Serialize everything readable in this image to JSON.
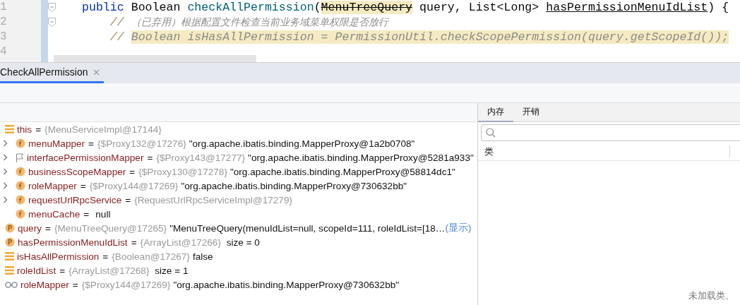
{
  "editor": {
    "lines": [
      {
        "number": "1",
        "fold": true,
        "tokens": [
          {
            "kind": "keyword",
            "text": "public"
          },
          {
            "kind": "plain",
            "text": " Boolean "
          },
          {
            "kind": "method",
            "text": "checkAllPermission"
          },
          {
            "kind": "plain",
            "text": "("
          },
          {
            "kind": "deprecated",
            "text": "MenuTreeQuery"
          },
          {
            "kind": "plain",
            "text": " query, List<Long> "
          },
          {
            "kind": "underlined",
            "text": "hasPermissionMenuIdList"
          },
          {
            "kind": "plain",
            "text": ") {"
          }
        ]
      },
      {
        "number": "2",
        "fold": true,
        "tokens": [
          {
            "kind": "slashes",
            "text": "    // "
          },
          {
            "kind": "comment",
            "text": "（已弃用）根据配置文件检查当前业务域菜单权限是否放行"
          }
        ]
      },
      {
        "number": "3",
        "fold": false,
        "tokens": [
          {
            "kind": "slashes",
            "text": "    // "
          },
          {
            "kind": "commented_code",
            "text": "Boolean isHasAllPermission = PermissionUtil.checkScopePermission(query.getScopeId());"
          }
        ]
      },
      {
        "number": "4",
        "fold": false
      }
    ]
  },
  "run_tab": {
    "label": "CheckAllPermission",
    "selected": true
  },
  "variables": [
    {
      "kind": "list",
      "name": "this",
      "operator": "=",
      "type": "{MenuServiceImpl@17144}",
      "children": [
        {
          "kind": "field",
          "expanded": false,
          "name": "menuMapper",
          "operator": "=",
          "type": "{$Proxy132@17276}",
          "value": "\"org.apache.ibatis.binding.MapperProxy@1a2b0708\""
        },
        {
          "kind": "flag",
          "expanded": false,
          "name": "interfacePermissionMapper",
          "operator": "=",
          "type": "{$Proxy143@17277}",
          "value": "\"org.apache.ibatis.binding.MapperProxy@5281a933\""
        },
        {
          "kind": "field",
          "expanded": false,
          "name": "businessScopeMapper",
          "operator": "=",
          "type": "{$Proxy130@17278}",
          "value": "\"org.apache.ibatis.binding.MapperProxy@58814dc1\""
        },
        {
          "kind": "field",
          "expanded": false,
          "name": "roleMapper",
          "operator": "=",
          "type": "{$Proxy144@17269}",
          "value": "\"org.apache.ibatis.binding.MapperProxy@730632bb\""
        },
        {
          "kind": "field",
          "expanded": false,
          "name": "requestUrlRpcService",
          "operator": "=",
          "type": "{RequestUrlRpcServiceImpl@17279}"
        },
        {
          "kind": "field",
          "name": "menuCache",
          "operator": "=",
          "value": "null"
        }
      ]
    },
    {
      "kind": "param",
      "name": "query",
      "operator": "=",
      "type": "{MenuTreeQuery@17265}",
      "value": "\"MenuTreeQuery(menuIdList=null, scopeId=111, roleIdList=[18…",
      "link": "(显示)"
    },
    {
      "kind": "param",
      "name": "hasPermissionMenuIdList",
      "operator": "=",
      "type": "{ArrayList@17266}",
      "value": " size = 0"
    },
    {
      "kind": "list",
      "name": "isHasAllPermission",
      "operator": "=",
      "type": "{Boolean@17267}",
      "value": "false"
    },
    {
      "kind": "list",
      "name": "roleIdList",
      "operator": "=",
      "type": "{ArrayList@17268}",
      "value": " size = 1"
    },
    {
      "kind": "watch",
      "name": "roleMapper",
      "operator": "=",
      "type": "{$Proxy144@17269}",
      "value": "\"org.apache.ibatis.binding.MapperProxy@730632bb\""
    }
  ],
  "memory_panel": {
    "tabs": [
      {
        "label": "内存",
        "selected": true
      },
      {
        "label": "开销",
        "selected": false
      }
    ],
    "columns": [
      "类"
    ],
    "empty_message": "未加载类。"
  }
}
